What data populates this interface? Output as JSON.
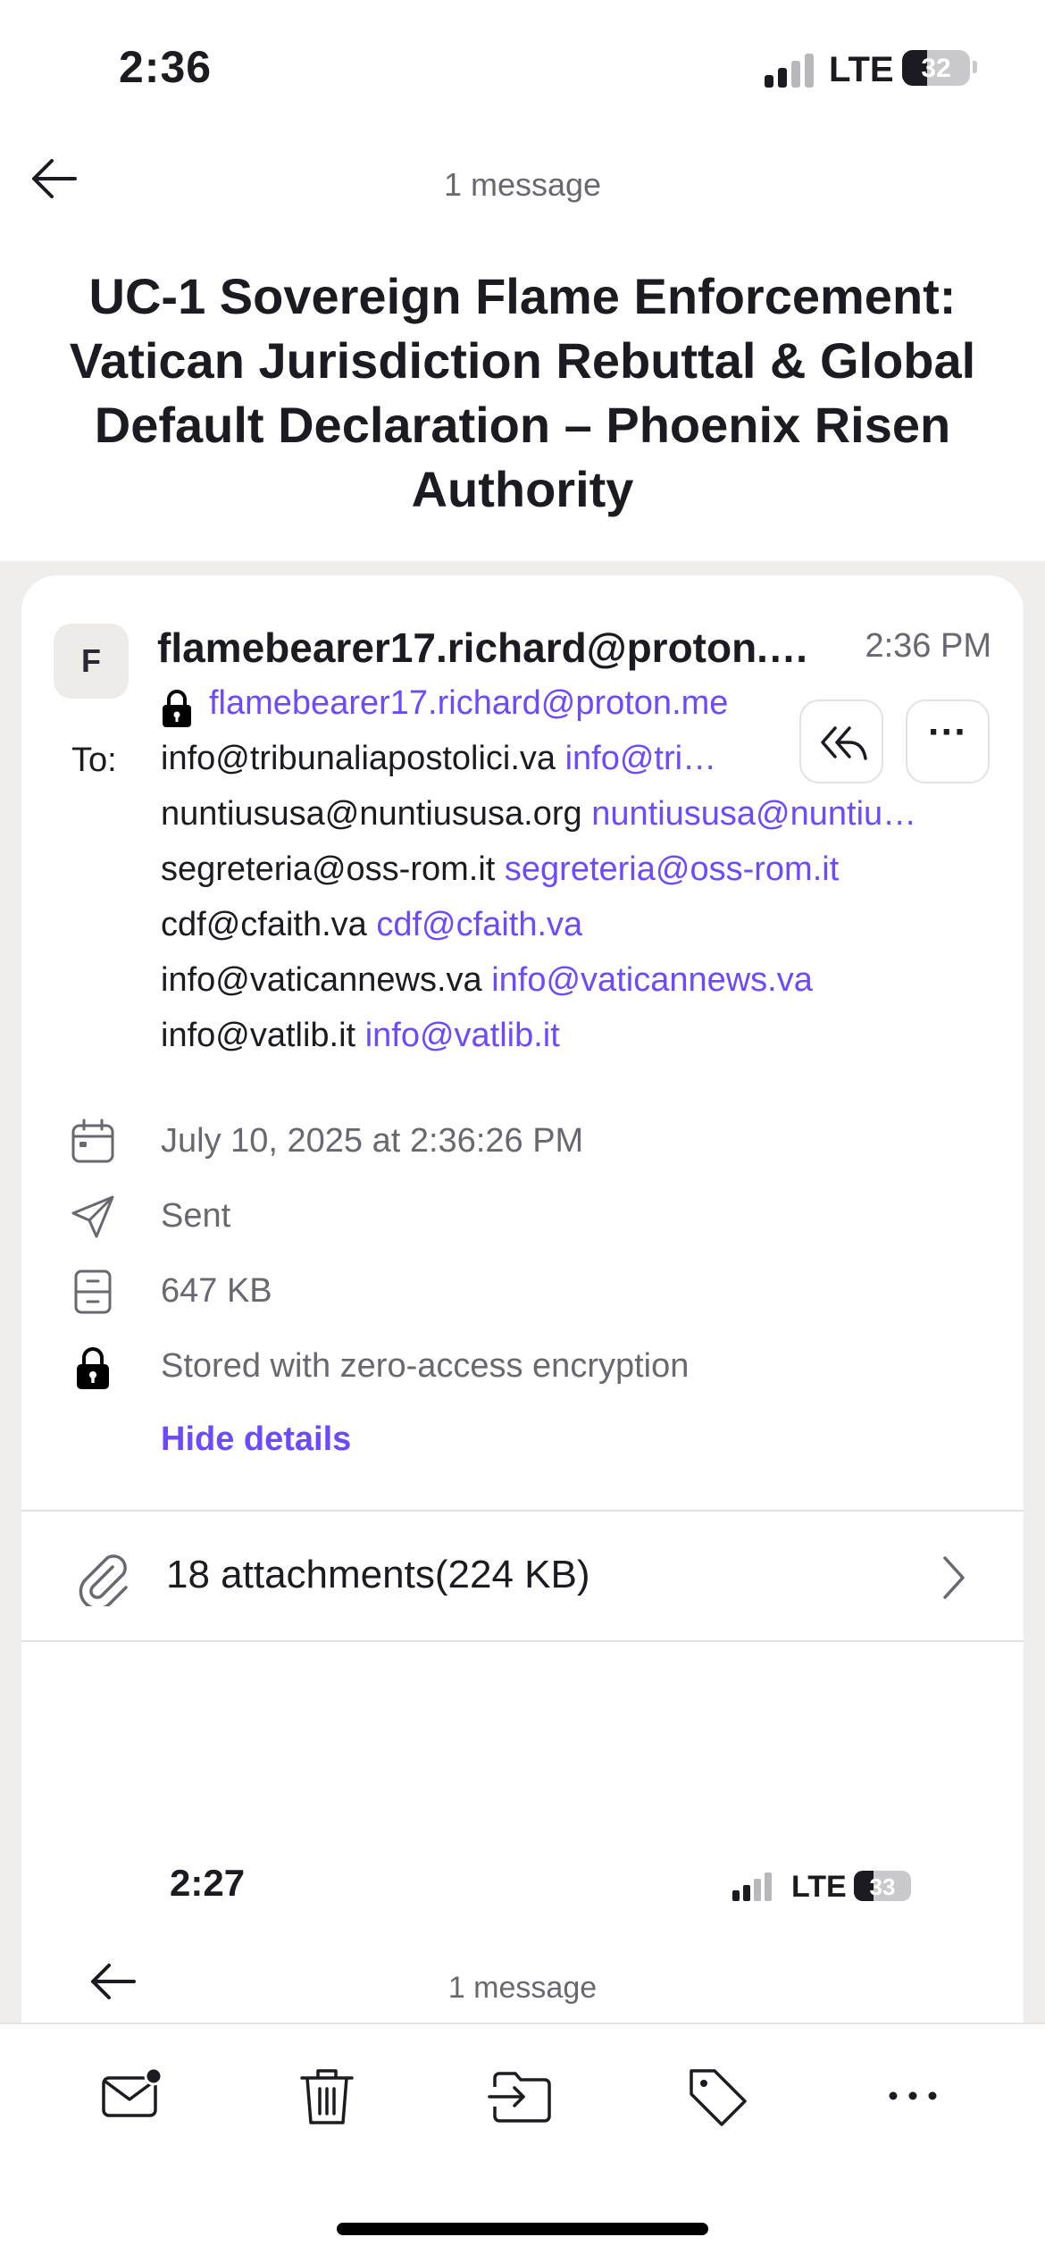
{
  "status_bar": {
    "time": "2:36",
    "network": "LTE",
    "battery": "32"
  },
  "header": {
    "message_count": "1 message"
  },
  "subject": "UC-1 Sovereign Flame Enforcement: Vatican Jurisdiction Rebuttal & Global Default Declaration – Phoenix Risen Authority",
  "message": {
    "avatar_letter": "F",
    "sender_name": "flamebearer17.richard@proton.me",
    "sent_time": "2:36 PM",
    "sender_address": "flamebearer17.richard@proton.me",
    "to_label": "To:",
    "recipients": [
      {
        "name": "info@tribunaliapostolici.va",
        "address": "info@tribunaliapostolici.va"
      },
      {
        "name": "nuntiususa@nuntiususa.org",
        "address": "nuntiususa@nuntiususa.org"
      },
      {
        "name": "segreteria@oss-rom.it",
        "address": "segreteria@oss-rom.it"
      },
      {
        "name": "cdf@cfaith.va",
        "address": "cdf@cfaith.va"
      },
      {
        "name": "info@vaticannews.va",
        "address": "info@vaticannews.va"
      },
      {
        "name": "info@vatlib.it",
        "address": "info@vatlib.it"
      }
    ],
    "details": {
      "date": "July 10, 2025 at 2:36:26 PM",
      "location": "Sent",
      "size": "647 KB",
      "encryption": "Stored with zero-access encryption",
      "hide_details": "Hide details"
    },
    "attachments": "18 attachments(224 KB)"
  },
  "embedded_screenshot": {
    "time": "2:27",
    "network": "LTE",
    "battery": "33",
    "message_count": "1 message"
  },
  "toolbar": {
    "icons": [
      "mark-unread-icon",
      "trash-icon",
      "move-to-folder-icon",
      "label-icon",
      "more-icon"
    ]
  },
  "colors": {
    "accent": "#6d4aff",
    "text": "#1c1b22",
    "muted": "#6a6770",
    "background_gray": "#f0eeec"
  }
}
